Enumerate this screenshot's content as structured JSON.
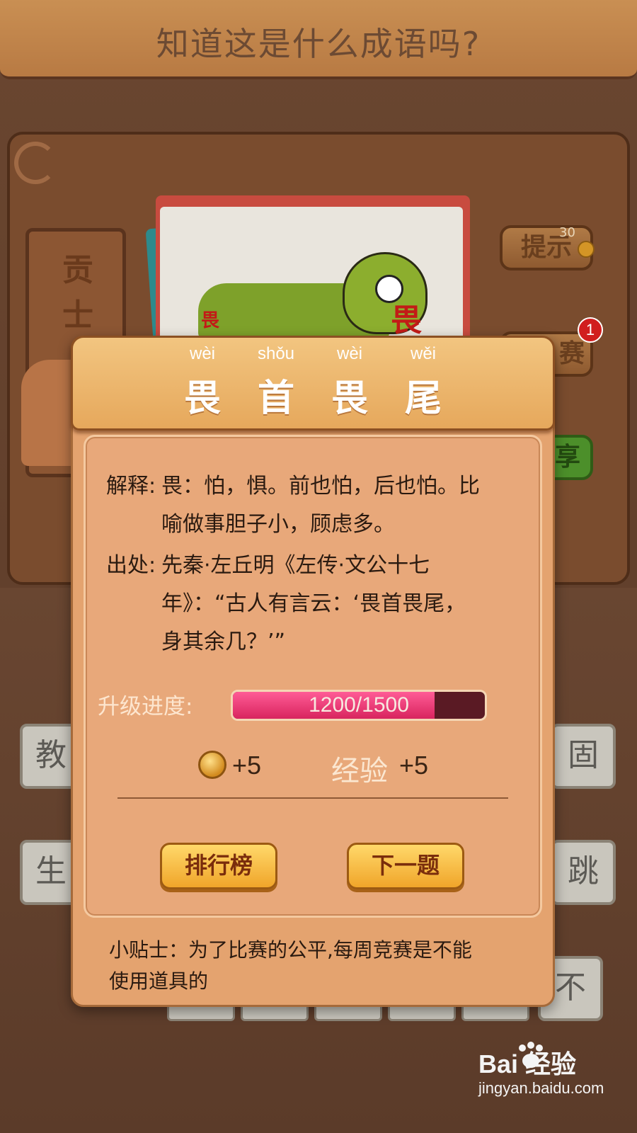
{
  "header": {
    "title": "知道这是什么成语吗?"
  },
  "stage": {
    "scroll_text": [
      "贡",
      "士"
    ],
    "card_chars": [
      "畏",
      "畏"
    ],
    "hint_button": "提示",
    "hint_cost": "30",
    "second_button_badge": "1",
    "second_button_fragment": "赛",
    "share_fragment": "享"
  },
  "tiles": {
    "left": [
      "教",
      "生"
    ],
    "right": [
      "固",
      "跳",
      "不"
    ]
  },
  "modal": {
    "pinyin": [
      "wèi",
      "shǒu",
      "wèi",
      "wěi"
    ],
    "idiom": [
      "畏",
      "首",
      "畏",
      "尾"
    ],
    "explanation_label": "解释:",
    "explanation_lines": [
      "畏：怕，惧。前也怕，后也怕。比",
      "喻做事胆子小，顾虑多。"
    ],
    "source_label": "出处:",
    "source_lines": [
      "先秦·左丘明《左传·文公十七",
      "年》：“古人有言云：‘畏首畏尾，",
      "身其余几？’”"
    ],
    "progress_label": "升级进度:",
    "progress_text": "1200/1500",
    "progress_value": 1200,
    "progress_max": 1500,
    "coin_reward": "+5",
    "exp_label": "经验",
    "exp_reward": "+5",
    "rank_button": "排行榜",
    "next_button": "下一题",
    "tip_lines": [
      "小贴士：为了比赛的公平,每周竞赛是不能",
      "使用道具的"
    ]
  },
  "watermark": {
    "logo": "Bai  经验",
    "url": "jingyan.baidu.com"
  },
  "colors": {
    "progress_fill": "#e0306a",
    "progress_track": "#5a1a24",
    "button_gold": "#f7c14a"
  }
}
